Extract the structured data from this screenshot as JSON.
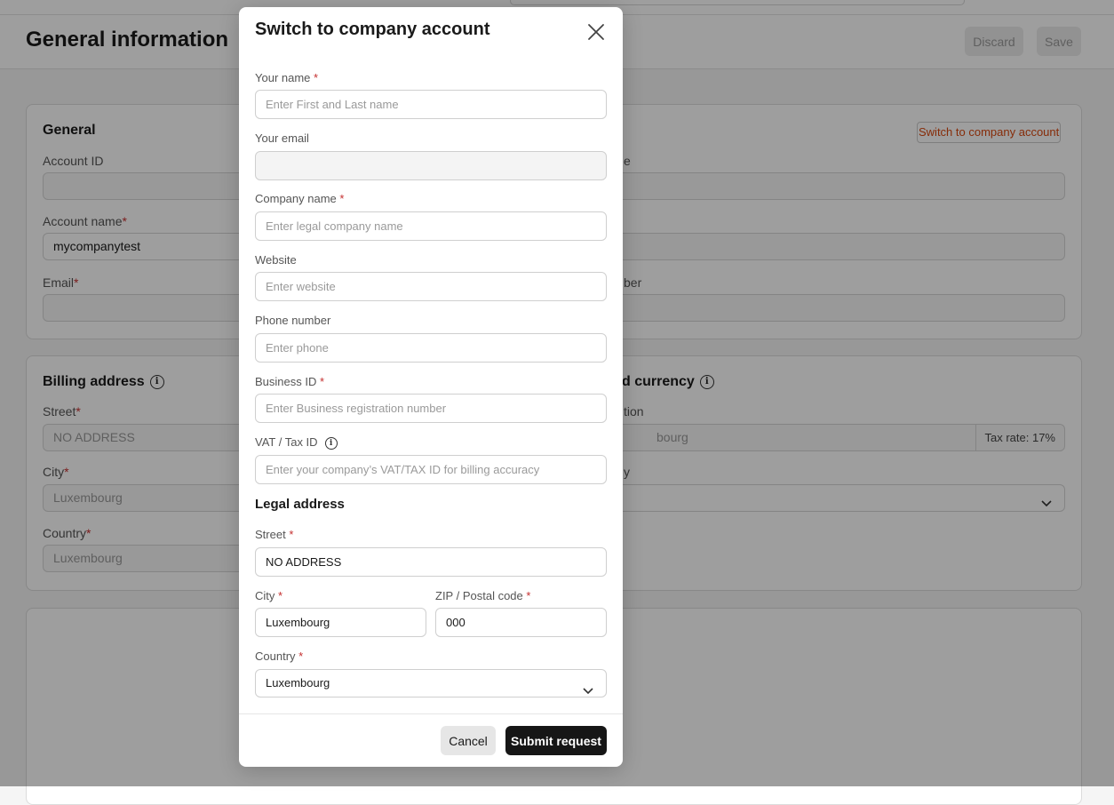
{
  "page": {
    "title": "General information",
    "discard_label": "Discard",
    "save_label": "Save"
  },
  "general_card": {
    "title": "General",
    "switch_link": "Switch to company account",
    "account_id_label": "Account ID",
    "account_name_label": "Account name",
    "account_name_value": "mycompanytest",
    "email_label": "Email",
    "right_label_1_partial": "e",
    "right_label_3_partial": "ber"
  },
  "billing_card": {
    "title": "Billing address",
    "street_label": "Street",
    "street_value": "NO ADDRESS",
    "city_label": "City",
    "city_value": "Luxembourg",
    "country_label": "Country",
    "country_value": "Luxembourg",
    "right_title_partial": "d currency",
    "right_label_1_partial": "tion",
    "right_value_1_partial": "bourg",
    "tax_rate": "Tax rate: 17%",
    "right_label_2_partial": "y"
  },
  "modal": {
    "title": "Switch to company account",
    "required_mark": "*",
    "your_name_label": "Your name",
    "your_name_placeholder": "Enter First and Last name",
    "your_email_label": "Your email",
    "your_email_value": "",
    "company_name_label": "Company name",
    "company_name_placeholder": "Enter legal company name",
    "website_label": "Website",
    "website_placeholder": "Enter website",
    "phone_label": "Phone number",
    "phone_placeholder": "Enter phone",
    "business_id_label": "Business ID",
    "business_id_placeholder": "Enter Business registration number",
    "vat_label": "VAT / Tax ID",
    "vat_placeholder": "Enter your company’s VAT/TAX ID for billing accuracy",
    "legal_address_title": "Legal address",
    "street_label": "Street",
    "street_value": "NO ADDRESS",
    "city_label": "City",
    "city_value": "Luxembourg",
    "zip_label": "ZIP / Postal code",
    "zip_value": "000",
    "country_label": "Country",
    "country_value": "Luxembourg",
    "cancel_label": "Cancel",
    "submit_label": "Submit request"
  },
  "icons": {
    "close": "close-icon",
    "info": "info-icon",
    "chevron": "chevron-down-icon"
  }
}
